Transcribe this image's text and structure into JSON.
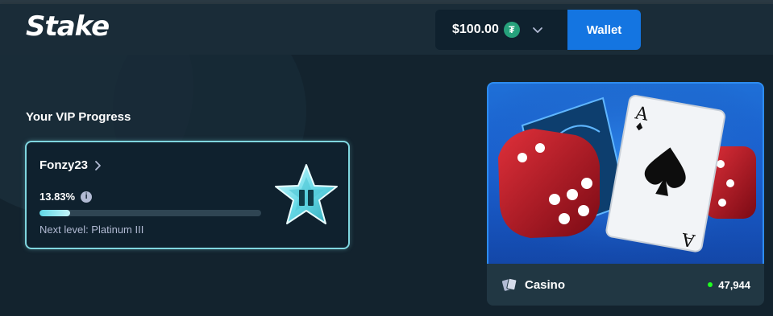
{
  "header": {
    "logo": "Stake",
    "balance": "$100.00",
    "currency_icon": "tether-icon",
    "currency_symbol": "₮",
    "wallet_label": "Wallet"
  },
  "vip": {
    "section_title": "Your VIP Progress",
    "username": "Fonzy23",
    "progress_text": "13.83%",
    "progress_fraction": 0.1383,
    "info_symbol": "i",
    "next_level": "Next level: Platinum III",
    "badge_icon": "platinum-star-icon"
  },
  "casino": {
    "label": "Casino",
    "player_count": "47,944",
    "art_icons": [
      "dice-icon",
      "playing-card-icon"
    ],
    "card_rank": "A"
  },
  "colors": {
    "background": "#1a2c38",
    "panel": "#0f212e",
    "accent_blue": "#1475e1",
    "vip_border": "#7fd6df",
    "live_green": "#1fff20",
    "muted_text": "#b1bad3"
  }
}
